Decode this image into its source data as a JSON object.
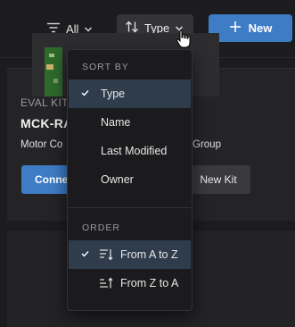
{
  "toolbar": {
    "filter_label": "All",
    "sort_label": "Type",
    "new_label": "New"
  },
  "card": {
    "eyebrow": "EVAL KIT",
    "title": "MCK-RA",
    "description_left": "Motor Co",
    "description_right": "Group",
    "connect_label": "Conne",
    "new_kit_label": "New Kit"
  },
  "dropdown": {
    "sort_header": "SORT BY",
    "sort_items": [
      "Type",
      "Name",
      "Last Modified",
      "Owner"
    ],
    "selected_sort": "Type",
    "order_header": "ORDER",
    "order_items": [
      "From A to Z",
      "From Z to A"
    ],
    "selected_order": "From A to Z"
  },
  "colors": {
    "background": "#1c1c1e",
    "accent": "#3e7cc6",
    "selected_item": "#2e3c4c",
    "menu_bg": "#1b1b1d"
  },
  "icons": [
    "filter-icon",
    "chevron-down-icon",
    "sort-arrows-icon",
    "plus-icon",
    "check-icon",
    "sort-ascending-icon",
    "sort-descending-icon",
    "hand-cursor-icon"
  ]
}
